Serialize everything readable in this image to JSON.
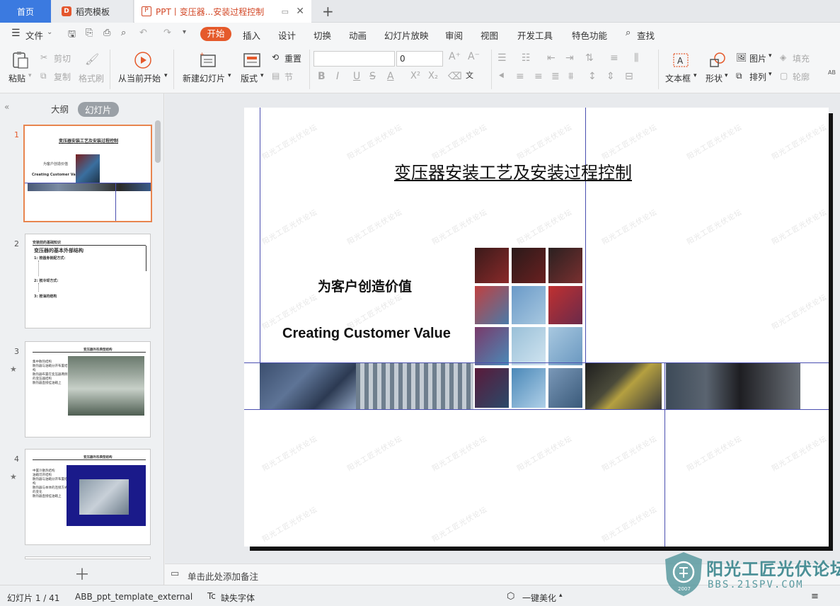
{
  "tabs": {
    "home": "首页",
    "docer": "稻壳模板",
    "active": "PPT丨变压器...安装过程控制",
    "new_tab": "+"
  },
  "menu": {
    "file": "文件",
    "items": [
      "开始",
      "插入",
      "设计",
      "切换",
      "动画",
      "幻灯片放映",
      "审阅",
      "视图",
      "开发工具",
      "特色功能"
    ],
    "search": "查找"
  },
  "ribbon": {
    "paste": "粘贴",
    "cut": "剪切",
    "copy": "复制",
    "format_painter": "格式刷",
    "from_current": "从当前开始",
    "new_slide": "新建幻灯片",
    "layout": "版式",
    "reset": "重置",
    "section": "节",
    "font_size": "0",
    "text_box": "文本框",
    "shape": "形状",
    "picture": "图片",
    "fill": "填充",
    "arrange": "排列",
    "outline": "轮廓"
  },
  "panel": {
    "outline_tab": "大纲",
    "slides_tab": "幻灯片",
    "slide_numbers": [
      "1",
      "2",
      "3",
      "4"
    ],
    "thumb1_title": "变压器安装工艺及安装过程控制",
    "thumb1_cn": "为客户创造价值",
    "thumb1_en": "Creating Customer Value",
    "thumb2_header": "安装前的基础知识",
    "thumb2_title": "变压器的基本外部结构",
    "thumb2_lines": [
      "1: 按器身装配方式:",
      "2: 按冷却方式:",
      "3: 按油的结构"
    ],
    "thumb3_title": "变压器外形典型结构",
    "thumb3_bullets": [
      "集中散热结构",
      "散热器与油箱分开布置结构",
      "散热器布置在变压器两侧的变压器结构",
      "散热器直接挂油箱上"
    ],
    "thumb4_title": "变压器外形典型结构",
    "thumb4_bullets": [
      "中置冷散热结构",
      "油箱可开结构",
      "散热器与油箱分开布置结构",
      "散热器与本体的连接方式的变化",
      "散热器直接挂油箱上"
    ]
  },
  "slide": {
    "title": "变压器安装工艺及安装过程控制",
    "subtitle_cn": "为客户创造价值",
    "subtitle_en": "Creating Customer Value"
  },
  "notes": {
    "placeholder": "单击此处添加备注"
  },
  "status": {
    "slide_count": "幻灯片 1 / 41",
    "template": "ABB_ppt_template_external",
    "missing_font": "缺失字体",
    "beautify": "一键美化"
  },
  "watermark": {
    "brand": "阳光工匠光伏论坛",
    "url": "BBS.21SPV.COM",
    "year": "2007"
  },
  "colors": {
    "accent": "#e55a2b",
    "guide_line": "#4a4fb0",
    "home_tab": "#3b7ae0"
  }
}
